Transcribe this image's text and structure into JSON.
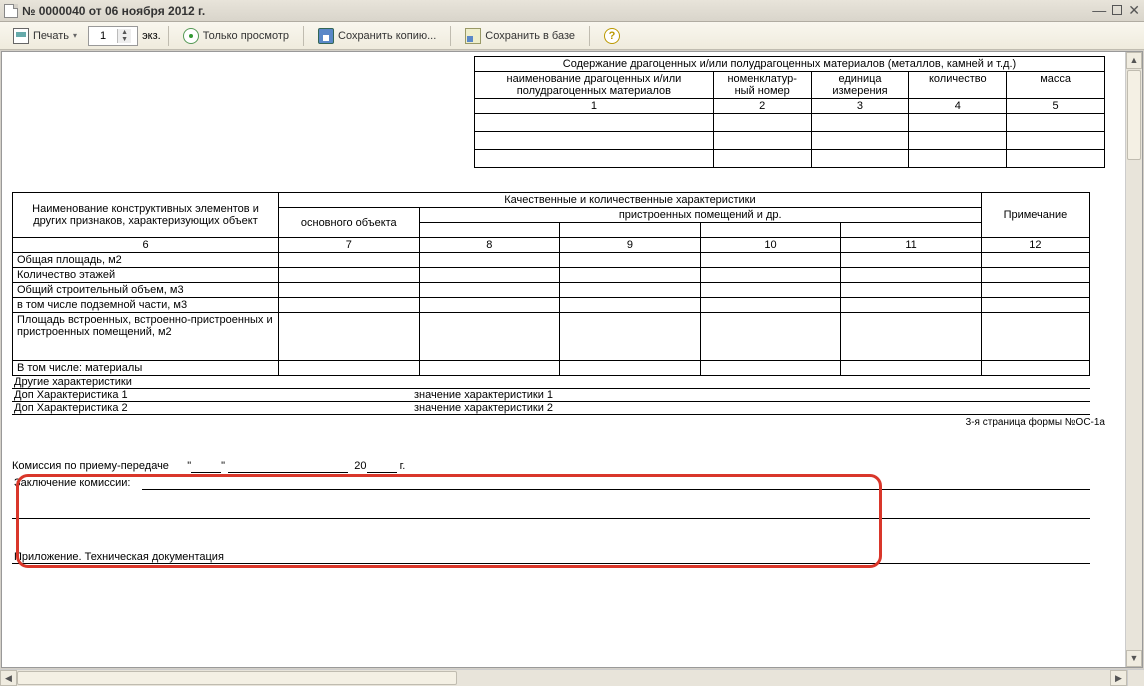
{
  "window": {
    "title": "№ 0000040  от 06 ноября 2012 г."
  },
  "toolbar": {
    "print_label": "Печать",
    "copies_value": "1",
    "copies_suffix": "экз.",
    "preview_label": "Только просмотр",
    "save_copy_label": "Сохранить копию...",
    "save_db_label": "Сохранить в базе",
    "help_glyph": "?"
  },
  "table1": {
    "header_main": "Содержание драгоценных и/или полудрагоценных материалов (металлов, камней и т.д.)",
    "col1": "наименование драгоценных и/или полудрагоценных материалов",
    "col2": "номенклатур-\nный номер",
    "col3": "единица измерения",
    "col4": "количество",
    "col5": "масса",
    "n1": "1",
    "n2": "2",
    "n3": "3",
    "n4": "4",
    "n5": "5"
  },
  "table2": {
    "h_left": "Наименование конструктивных элементов и других признаков, характеризующих объект",
    "h_mid": "Качественные и количественные характеристики",
    "h_mid_sub1": "основного объекта",
    "h_mid_sub2": "пристроенных помещений и др.",
    "h_right": "Примечание",
    "n6": "6",
    "n7": "7",
    "n8": "8",
    "n9": "9",
    "n10": "10",
    "n11": "11",
    "n12": "12",
    "rows": [
      "Общая площадь, м2",
      "Количество этажей",
      "Общий строительный объем, м3",
      "в том числе подземной части, м3",
      "Площадь встроенных, встроенно-пристроенных и пристроенных помещений, м2",
      "В том числе: материалы"
    ]
  },
  "extra": {
    "other_label": "Другие характеристики",
    "r1_name": "Доп Характеристика 1",
    "r1_val": "значение характеристики 1",
    "r2_name": "Доп Характеристика 2",
    "r2_val": "значение характеристики 2"
  },
  "page_note": "3-я страница формы №ОС-1а",
  "commission": {
    "line1_prefix": "Комиссия по приему-передаче",
    "quote1": "\"",
    "quote2": "\"",
    "year_prefix": "20",
    "year_suffix": "г.",
    "line2": "Заключение комиссии:"
  },
  "attachment": "Приложение. Техническая документация"
}
